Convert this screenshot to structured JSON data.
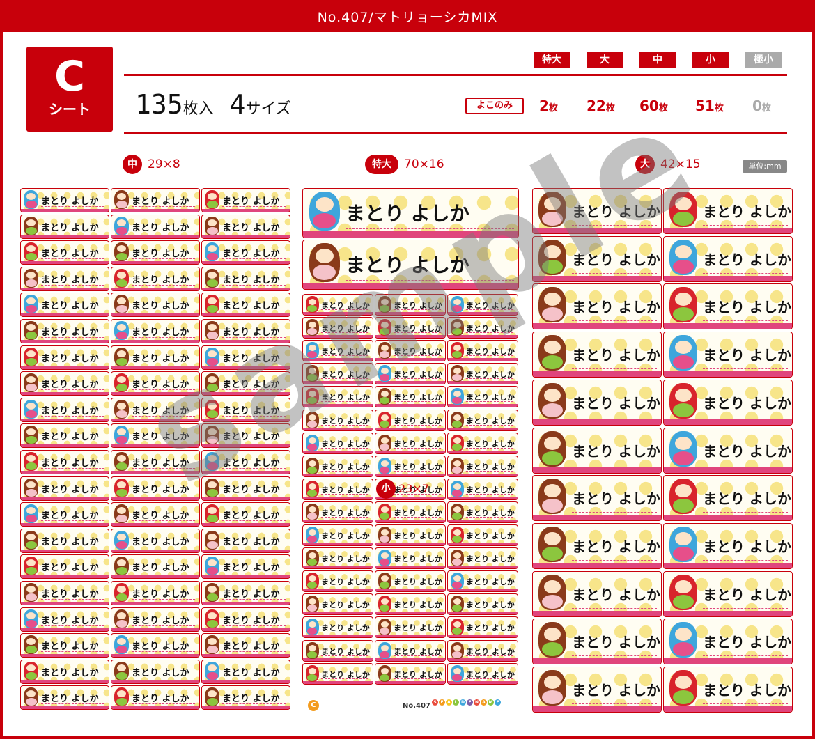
{
  "header": {
    "title": "No.407/マトリョーシカMIX"
  },
  "sheet_badge": {
    "letter": "C",
    "word": "シート"
  },
  "count": {
    "number": "135",
    "unit": "枚入",
    "sizes_number": "4",
    "sizes_unit": "サイズ"
  },
  "size_tags": [
    {
      "label": "特大",
      "qty": "2",
      "active": true
    },
    {
      "label": "大",
      "qty": "22",
      "active": true
    },
    {
      "label": "中",
      "qty": "60",
      "active": true
    },
    {
      "label": "小",
      "qty": "51",
      "active": true
    },
    {
      "label": "極小",
      "qty": "0",
      "active": false
    }
  ],
  "qty_unit": "枚",
  "yoko_label": "よこのみ",
  "columns": {
    "left": {
      "badge": "中",
      "dims": "29×8"
    },
    "center": {
      "badge": "特大",
      "dims": "70×16"
    },
    "right": {
      "badge": "大",
      "dims": "42×15"
    }
  },
  "unit_label": "単位:mm",
  "small_badge": {
    "badge": "小",
    "dims": "23×7"
  },
  "label_text": "まとり よしか",
  "watermark": "sample",
  "footer": {
    "sheet_mark": "C",
    "product_no": "No.407",
    "brand": "SEALDENAME"
  },
  "colors": {
    "brand_red": "#c8000b",
    "dot_yellow": "#f7e58a",
    "base_pink": "#e0457d",
    "doll_blue": "#3ea6dc",
    "doll_brown": "#8a3a1a",
    "doll_red": "#d8242c",
    "doll_green": "#8cc63e"
  }
}
